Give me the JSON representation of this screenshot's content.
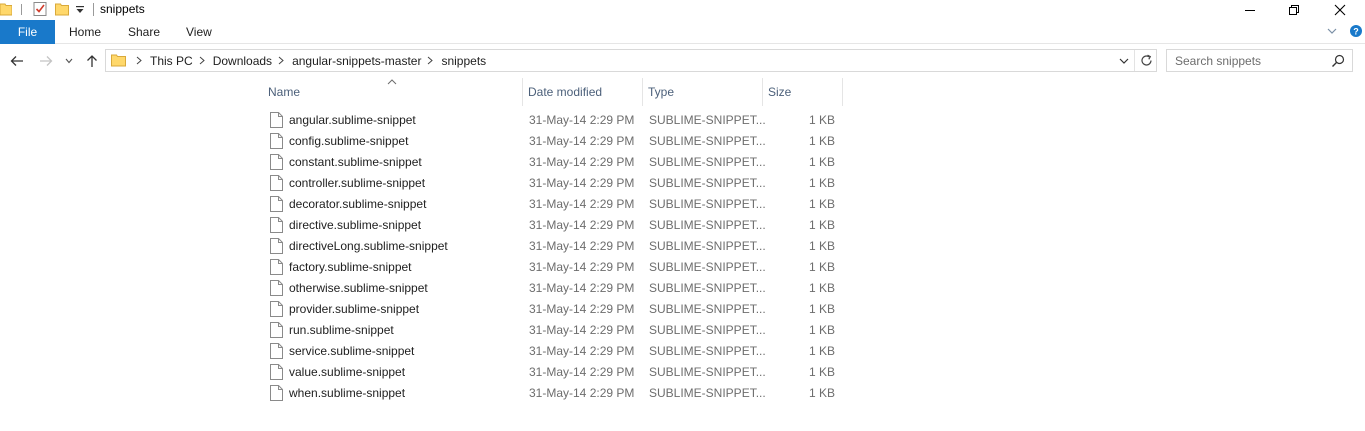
{
  "window": {
    "title": "snippets",
    "minimize_glyph": "—",
    "close_glyph": "✕"
  },
  "ribbon": {
    "tabs": [
      {
        "label": "File"
      },
      {
        "label": "Home"
      },
      {
        "label": "Share"
      },
      {
        "label": "View"
      }
    ]
  },
  "address": {
    "breadcrumbs": [
      "This PC",
      "Downloads",
      "angular-snippets-master",
      "snippets"
    ]
  },
  "search": {
    "placeholder": "Search snippets",
    "value": ""
  },
  "columns": [
    "Name",
    "Date modified",
    "Type",
    "Size"
  ],
  "files": [
    {
      "name": "angular.sublime-snippet",
      "date": "31-May-14 2:29 PM",
      "type": "SUBLIME-SNIPPET...",
      "size": "1 KB"
    },
    {
      "name": "config.sublime-snippet",
      "date": "31-May-14 2:29 PM",
      "type": "SUBLIME-SNIPPET...",
      "size": "1 KB"
    },
    {
      "name": "constant.sublime-snippet",
      "date": "31-May-14 2:29 PM",
      "type": "SUBLIME-SNIPPET...",
      "size": "1 KB"
    },
    {
      "name": "controller.sublime-snippet",
      "date": "31-May-14 2:29 PM",
      "type": "SUBLIME-SNIPPET...",
      "size": "1 KB"
    },
    {
      "name": "decorator.sublime-snippet",
      "date": "31-May-14 2:29 PM",
      "type": "SUBLIME-SNIPPET...",
      "size": "1 KB"
    },
    {
      "name": "directive.sublime-snippet",
      "date": "31-May-14 2:29 PM",
      "type": "SUBLIME-SNIPPET...",
      "size": "1 KB"
    },
    {
      "name": "directiveLong.sublime-snippet",
      "date": "31-May-14 2:29 PM",
      "type": "SUBLIME-SNIPPET...",
      "size": "1 KB"
    },
    {
      "name": "factory.sublime-snippet",
      "date": "31-May-14 2:29 PM",
      "type": "SUBLIME-SNIPPET...",
      "size": "1 KB"
    },
    {
      "name": "otherwise.sublime-snippet",
      "date": "31-May-14 2:29 PM",
      "type": "SUBLIME-SNIPPET...",
      "size": "1 KB"
    },
    {
      "name": "provider.sublime-snippet",
      "date": "31-May-14 2:29 PM",
      "type": "SUBLIME-SNIPPET...",
      "size": "1 KB"
    },
    {
      "name": "run.sublime-snippet",
      "date": "31-May-14 2:29 PM",
      "type": "SUBLIME-SNIPPET...",
      "size": "1 KB"
    },
    {
      "name": "service.sublime-snippet",
      "date": "31-May-14 2:29 PM",
      "type": "SUBLIME-SNIPPET...",
      "size": "1 KB"
    },
    {
      "name": "value.sublime-snippet",
      "date": "31-May-14 2:29 PM",
      "type": "SUBLIME-SNIPPET...",
      "size": "1 KB"
    },
    {
      "name": "when.sublime-snippet",
      "date": "31-May-14 2:29 PM",
      "type": "SUBLIME-SNIPPET...",
      "size": "1 KB"
    }
  ],
  "sort": {
    "column": "Name",
    "direction": "ascending"
  },
  "colors": {
    "file_tab": "#1979ca",
    "folder": "#ffd86b",
    "header_text": "#4c607a",
    "muted_text": "#6d6d6d"
  },
  "icons": {
    "quick_access": [
      "folder-icon",
      "properties-check-icon",
      "new-folder-icon",
      "customize-dropdown-icon"
    ],
    "window": [
      "minimize-icon",
      "maximize-icon",
      "close-icon"
    ],
    "nav": [
      "back-arrow-icon",
      "forward-arrow-icon",
      "recent-locations-icon",
      "up-arrow-icon"
    ],
    "file": "document-icon"
  }
}
